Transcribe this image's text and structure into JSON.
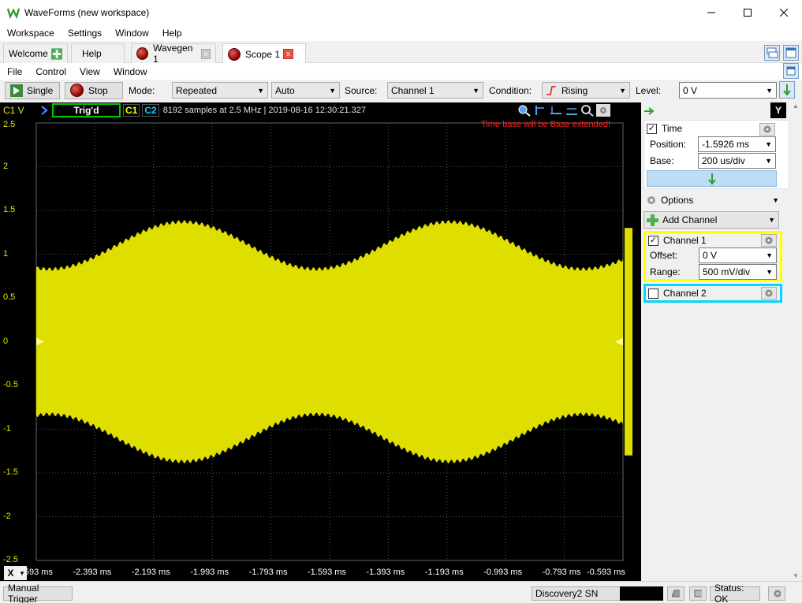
{
  "window": {
    "title": "WaveForms (new workspace)"
  },
  "menu": [
    "Workspace",
    "Settings",
    "Window",
    "Help"
  ],
  "tabs": [
    {
      "label": "Welcome",
      "icon": "plus-icon"
    },
    {
      "label": "Help"
    },
    {
      "label": "Wavegen 1",
      "icon": "instrument-icon",
      "close": "x"
    },
    {
      "label": "Scope 1",
      "icon": "instrument-icon",
      "close": "x"
    }
  ],
  "scope_menu": [
    "File",
    "Control",
    "View",
    "Window"
  ],
  "toolbar": {
    "single": "Single",
    "stop": "Stop",
    "mode_label": "Mode:",
    "mode_value": "Repeated",
    "auto_value": "Auto",
    "source_label": "Source:",
    "source_value": "Channel 1",
    "condition_label": "Condition:",
    "condition_value": "Rising",
    "level_label": "Level:",
    "level_value": "0 V"
  },
  "plot": {
    "channel_unit": "C1 V",
    "trig_status": "Trig'd",
    "c1": "C1",
    "c2": "C2",
    "sample_info": "8192 samples at 2.5 MHz | 2019-08-16 12:30:21.327",
    "warning": "Time base will be Base extended!",
    "y_labels": [
      "2.5",
      "2",
      "1.5",
      "1",
      "0.5",
      "0",
      "-0.5",
      "-1",
      "-1.5",
      "-2",
      "-2.5"
    ],
    "x_labels": [
      "-2.593 ms",
      "-2.393 ms",
      "-2.193 ms",
      "-1.993 ms",
      "-1.793 ms",
      "-1.593 ms",
      "-1.393 ms",
      "-1.193 ms",
      "-0.993 ms",
      "-0.793 ms",
      "-0.593 ms"
    ],
    "x_button": "X",
    "trace_color": "#dede00"
  },
  "panel": {
    "y_button": "Y",
    "time": {
      "label": "Time",
      "position_label": "Position:",
      "position_value": "-1.5926 ms",
      "base_label": "Base:",
      "base_value": "200 us/div"
    },
    "options": "Options",
    "add_channel": "Add Channel",
    "ch1": {
      "label": "Channel 1",
      "offset_label": "Offset:",
      "offset_value": "0 V",
      "range_label": "Range:",
      "range_value": "500 mV/div",
      "color": "#ffff00"
    },
    "ch2": {
      "label": "Channel 2",
      "color": "#00d8ff"
    }
  },
  "status": {
    "manual_trigger": "Manual Trigger",
    "device": "Discovery2 SN",
    "status": "Status: OK"
  }
}
